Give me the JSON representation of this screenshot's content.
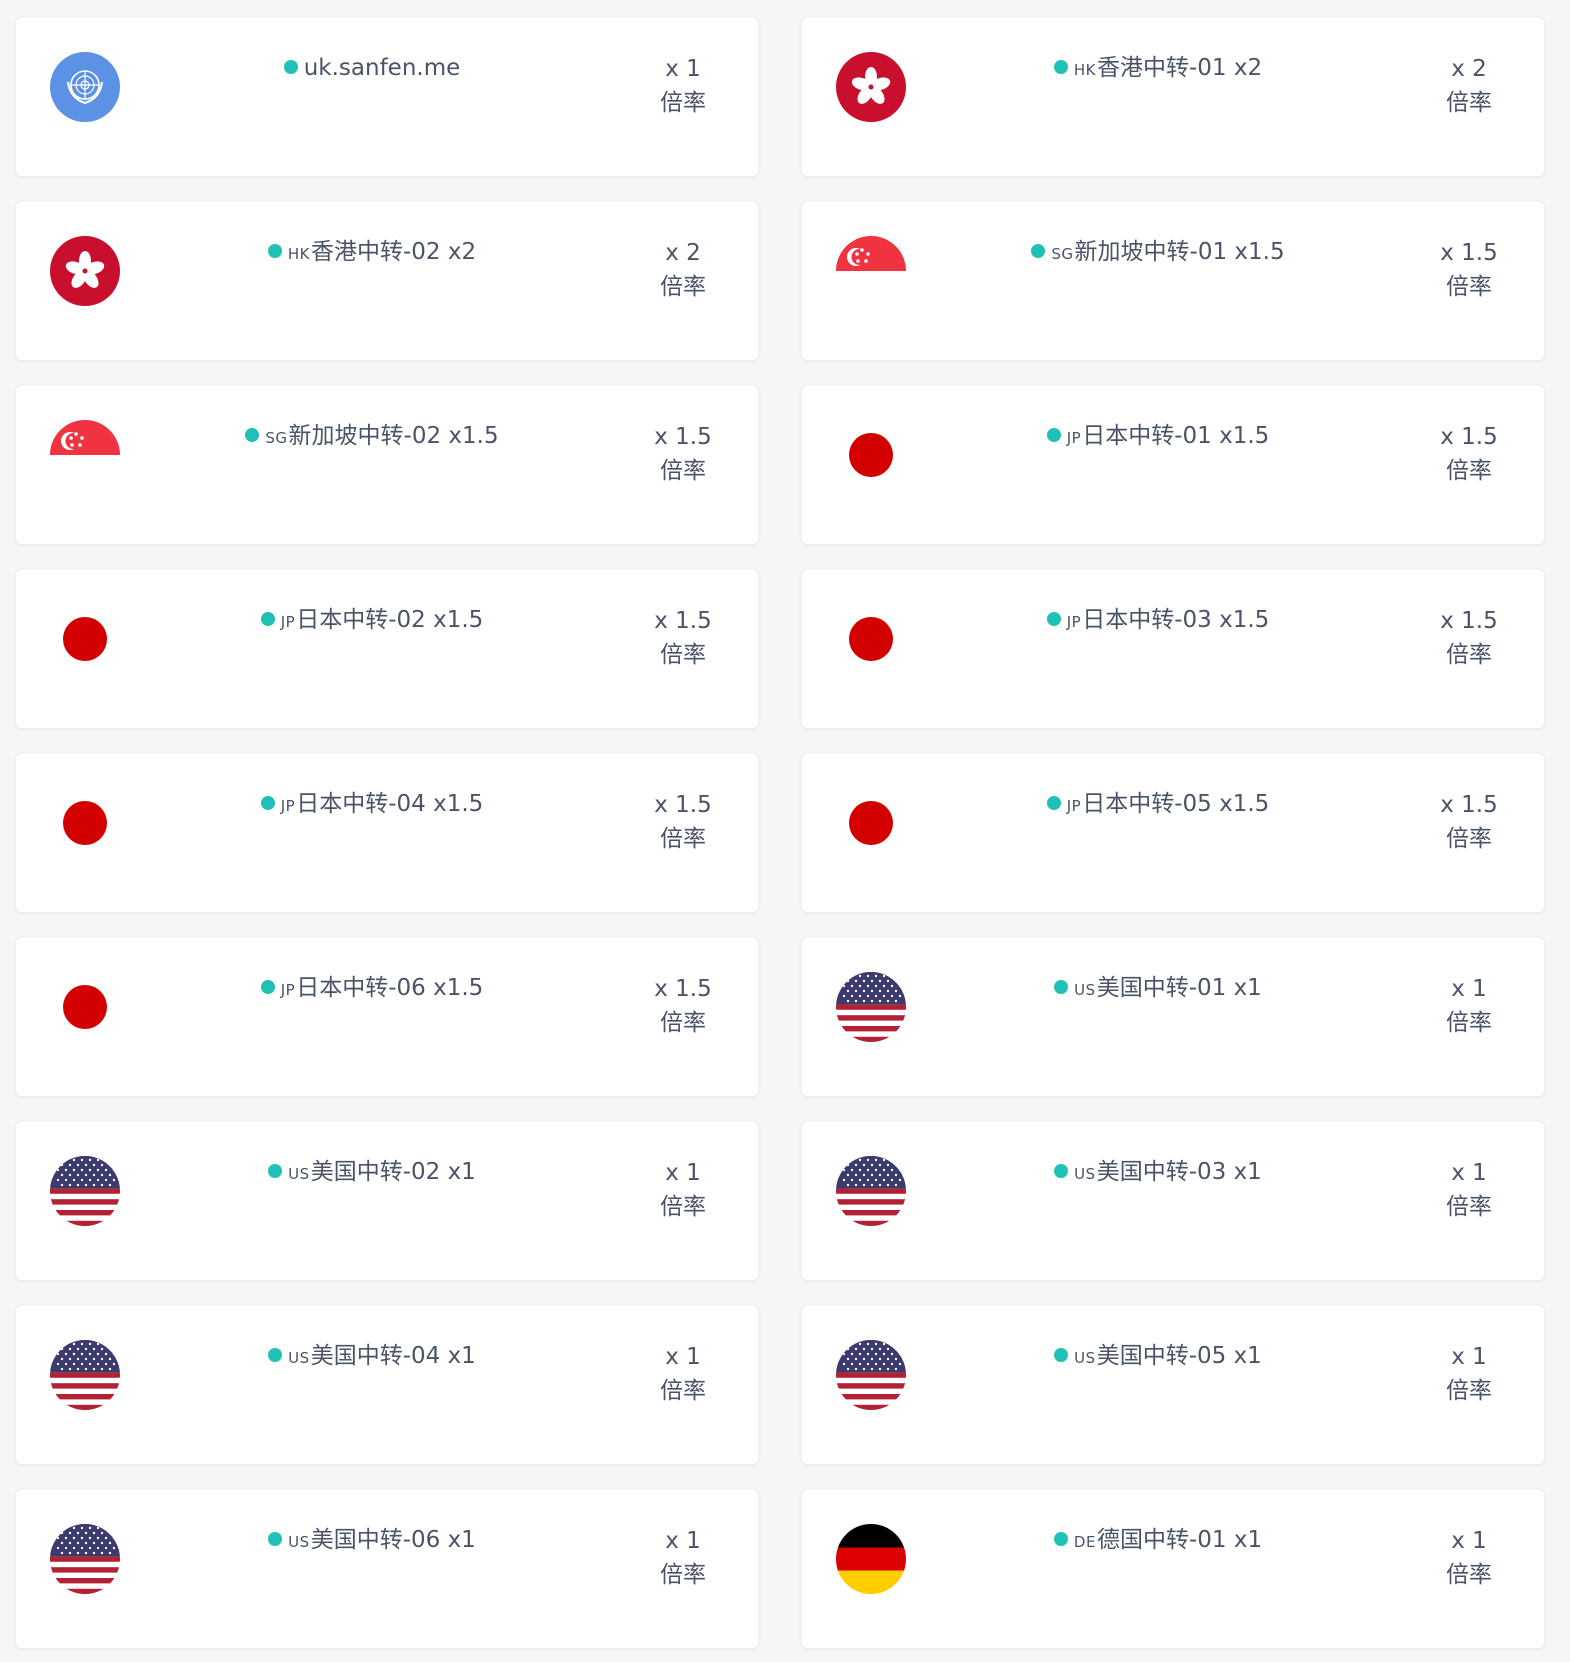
{
  "colors": {
    "status_online": "#1fc0b6",
    "card_bg": "#ffffff",
    "page_bg": "#f5f6f8",
    "text": "#4a5468"
  },
  "rate_label": "倍率",
  "nodes": [
    {
      "flag": "un-flag-icon",
      "code": "",
      "name": "uk.sanfen.me",
      "mult": "x 1"
    },
    {
      "flag": "hk-flag-icon",
      "code": "HK",
      "name": "香港中转-01 x2",
      "mult": "x 2"
    },
    {
      "flag": "hk-flag-icon",
      "code": "HK",
      "name": "香港中转-02 x2",
      "mult": "x 2"
    },
    {
      "flag": "sg-flag-icon",
      "code": "SG",
      "name": "新加坡中转-01 x1.5",
      "mult": "x 1.5"
    },
    {
      "flag": "sg-flag-icon",
      "code": "SG",
      "name": "新加坡中转-02 x1.5",
      "mult": "x 1.5"
    },
    {
      "flag": "jp-flag-icon",
      "code": "JP",
      "name": "日本中转-01 x1.5",
      "mult": "x 1.5"
    },
    {
      "flag": "jp-flag-icon",
      "code": "JP",
      "name": "日本中转-02 x1.5",
      "mult": "x 1.5"
    },
    {
      "flag": "jp-flag-icon",
      "code": "JP",
      "name": "日本中转-03 x1.5",
      "mult": "x 1.5"
    },
    {
      "flag": "jp-flag-icon",
      "code": "JP",
      "name": "日本中转-04 x1.5",
      "mult": "x 1.5"
    },
    {
      "flag": "jp-flag-icon",
      "code": "JP",
      "name": "日本中转-05 x1.5",
      "mult": "x 1.5"
    },
    {
      "flag": "jp-flag-icon",
      "code": "JP",
      "name": "日本中转-06 x1.5",
      "mult": "x 1.5"
    },
    {
      "flag": "us-flag-icon",
      "code": "US",
      "name": "美国中转-01 x1",
      "mult": "x 1"
    },
    {
      "flag": "us-flag-icon",
      "code": "US",
      "name": "美国中转-02 x1",
      "mult": "x 1"
    },
    {
      "flag": "us-flag-icon",
      "code": "US",
      "name": "美国中转-03 x1",
      "mult": "x 1"
    },
    {
      "flag": "us-flag-icon",
      "code": "US",
      "name": "美国中转-04 x1",
      "mult": "x 1"
    },
    {
      "flag": "us-flag-icon",
      "code": "US",
      "name": "美国中转-05 x1",
      "mult": "x 1"
    },
    {
      "flag": "us-flag-icon",
      "code": "US",
      "name": "美国中转-06 x1",
      "mult": "x 1"
    },
    {
      "flag": "de-flag-icon",
      "code": "DE",
      "name": "德国中转-01 x1",
      "mult": "x 1"
    }
  ]
}
